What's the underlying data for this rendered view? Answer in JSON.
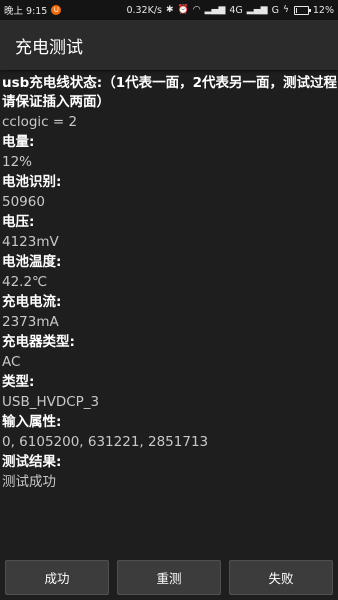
{
  "statusbar": {
    "time": "晚上 9:15",
    "notification_badge": "U",
    "speed": "0.32K/s",
    "signal1": "4G",
    "signal2": "G",
    "battery": "12%",
    "battery_level": 0.12
  },
  "app": {
    "title": "充电测试"
  },
  "fields": [
    {
      "label": "usb充电线状态:（1代表一面，2代表另一面，测试过程请保证插入两面）",
      "value": "cclogic = 2"
    },
    {
      "label": "电量:",
      "value": "12%"
    },
    {
      "label": "电池识别:",
      "value": "50960"
    },
    {
      "label": "电压:",
      "value": "4123mV"
    },
    {
      "label": "电池温度:",
      "value": "42.2℃"
    },
    {
      "label": "充电电流:",
      "value": "2373mA"
    },
    {
      "label": "充电器类型:",
      "value": "AC"
    },
    {
      "label": "类型:",
      "value": "USB_HVDCP_3"
    },
    {
      "label": "输入属性:",
      "value": "0, 6105200, 631221, 2851713"
    },
    {
      "label": "测试结果:",
      "value": "测试成功"
    }
  ],
  "buttons": {
    "success": "成功",
    "retest": "重测",
    "fail": "失败"
  }
}
